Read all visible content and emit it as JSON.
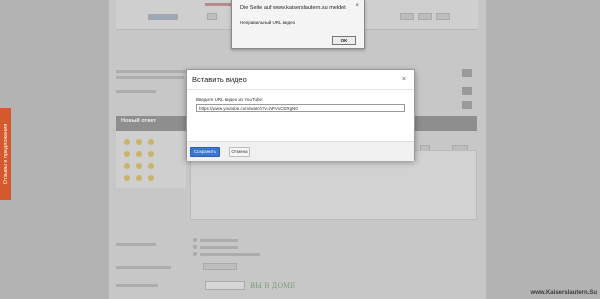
{
  "alert": {
    "title": "Die Seite auf www.kaiserslautern.su meldet",
    "message": "Неправильный URL видео",
    "ok_label": "OK",
    "close_glyph": "×"
  },
  "modal": {
    "title": "Вставить видео",
    "close_glyph": "×",
    "url_label": "Введите URL видео из YouTube:",
    "url_value": "https://www.youtube.com/watch?v=hPVxCERgN0",
    "save_label": "Сохранить",
    "cancel_label": "Отмена"
  },
  "background": {
    "section_heading": "Новый ответ",
    "feedback_tab": "Отзывы и предложения",
    "handwriting": "ВЫ В ДОМЕ",
    "watermark": "www.Kaiserslautern.Su"
  }
}
